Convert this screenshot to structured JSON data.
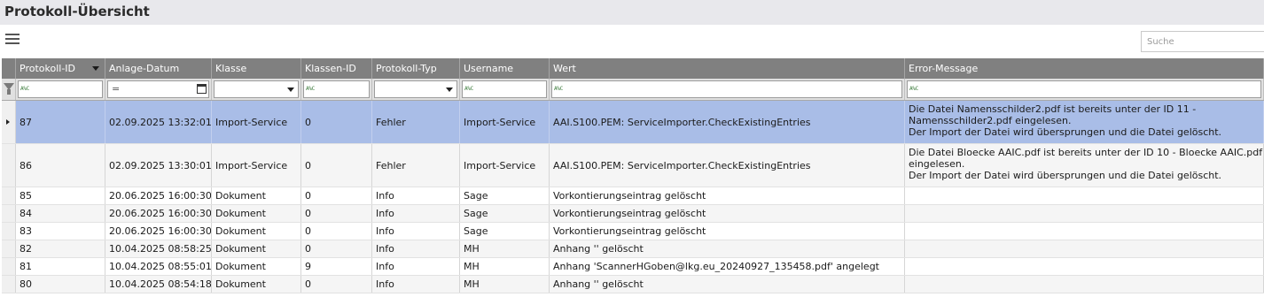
{
  "window": {
    "title": "Protokoll-Übersicht"
  },
  "toolbar": {
    "menu_icon": "hamburger-menu-icon",
    "search_placeholder": "Suche",
    "search_value": ""
  },
  "colors": {
    "header_bg": "#808080",
    "selected_row": "#a9bde7",
    "titlebar_bg": "#e8e8ec"
  },
  "table": {
    "columns": [
      "Protokoll-ID",
      "Anlage-Datum",
      "Klasse",
      "Klassen-ID",
      "Protokoll-Typ",
      "Username",
      "Wert",
      "Error-Message"
    ],
    "sorted_column": "Protokoll-ID",
    "filter_indicator": "A%C",
    "filter_equals_symbol": "=",
    "rows": [
      {
        "id": "87",
        "date": "02.09.2025 13:32:01",
        "klasse": "Import-Service",
        "klassen_id": "0",
        "typ": "Fehler",
        "user": "Import-Service",
        "wert": "AAI.S100.PEM: ServiceImporter.CheckExistingEntries",
        "error": "Die Datei Namensschilder2.pdf ist bereits unter der ID 11 - Namensschilder2.pdf eingelesen.\nDer Import der Datei wird übersprungen und die Datei gelöscht.",
        "selected": true
      },
      {
        "id": "86",
        "date": "02.09.2025 13:30:01",
        "klasse": "Import-Service",
        "klassen_id": "0",
        "typ": "Fehler",
        "user": "Import-Service",
        "wert": "AAI.S100.PEM: ServiceImporter.CheckExistingEntries",
        "error": "Die Datei Bloecke AAIC.pdf ist bereits unter der ID 10 - Bloecke AAIC.pdf eingelesen.\nDer Import der Datei wird übersprungen und die Datei gelöscht.",
        "selected": false
      },
      {
        "id": "85",
        "date": "20.06.2025 16:00:30",
        "klasse": "Dokument",
        "klassen_id": "0",
        "typ": "Info",
        "user": "Sage",
        "wert": "Vorkontierungseintrag gelöscht",
        "error": "",
        "selected": false
      },
      {
        "id": "84",
        "date": "20.06.2025 16:00:30",
        "klasse": "Dokument",
        "klassen_id": "0",
        "typ": "Info",
        "user": "Sage",
        "wert": "Vorkontierungseintrag gelöscht",
        "error": "",
        "selected": false
      },
      {
        "id": "83",
        "date": "20.06.2025 16:00:30",
        "klasse": "Dokument",
        "klassen_id": "0",
        "typ": "Info",
        "user": "Sage",
        "wert": "Vorkontierungseintrag gelöscht",
        "error": "",
        "selected": false
      },
      {
        "id": "82",
        "date": "10.04.2025 08:58:25",
        "klasse": "Dokument",
        "klassen_id": "0",
        "typ": "Info",
        "user": "MH",
        "wert": "Anhang '' gelöscht",
        "error": "",
        "selected": false
      },
      {
        "id": "81",
        "date": "10.04.2025 08:55:01",
        "klasse": "Dokument",
        "klassen_id": "9",
        "typ": "Info",
        "user": "MH",
        "wert": "Anhang 'ScannerHGoben@lkg.eu_20240927_135458.pdf' angelegt",
        "error": "",
        "selected": false
      },
      {
        "id": "80",
        "date": "10.04.2025 08:54:18",
        "klasse": "Dokument",
        "klassen_id": "0",
        "typ": "Info",
        "user": "MH",
        "wert": "Anhang '' gelöscht",
        "error": "",
        "selected": false
      }
    ]
  }
}
